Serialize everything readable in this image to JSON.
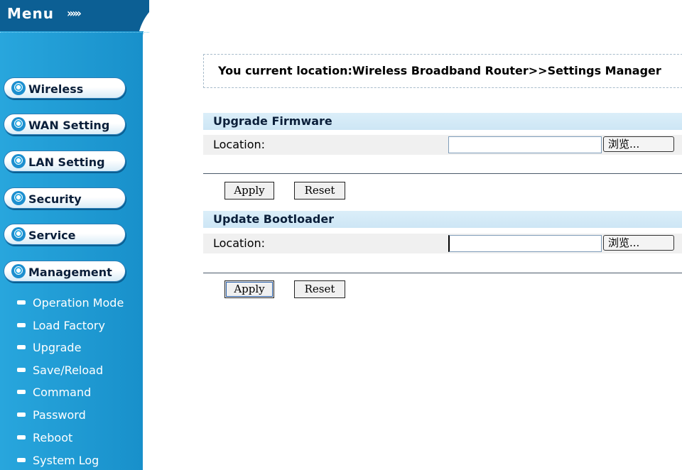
{
  "sidebar": {
    "title": "Menu",
    "arrows": "›››››",
    "nav": [
      {
        "label": "Wireless"
      },
      {
        "label": "WAN Setting"
      },
      {
        "label": "LAN Setting"
      },
      {
        "label": "Security"
      },
      {
        "label": "Service"
      },
      {
        "label": "Management"
      }
    ],
    "sub_items": [
      {
        "label": "Operation Mode"
      },
      {
        "label": "Load Factory"
      },
      {
        "label": "Upgrade"
      },
      {
        "label": "Save/Reload"
      },
      {
        "label": "Command"
      },
      {
        "label": "Password"
      },
      {
        "label": "Reboot"
      },
      {
        "label": "System Log"
      }
    ]
  },
  "location": {
    "text": "You current location:Wireless Broadband Router>>Settings Manager"
  },
  "firmware": {
    "title": "Upgrade Firmware",
    "location_label": "Location:",
    "file_value": "",
    "browse_label": "浏览...",
    "apply_label": "Apply",
    "reset_label": "Reset"
  },
  "bootloader": {
    "title": "Update Bootloader",
    "location_label": "Location:",
    "file_value": "",
    "browse_label": "浏览...",
    "apply_label": "Apply",
    "reset_label": "Reset"
  },
  "colors": {
    "sidebar_blue": "#1a9ad6",
    "sidebar_dark": "#0b5f93",
    "section_header": "#d6ebf8"
  }
}
